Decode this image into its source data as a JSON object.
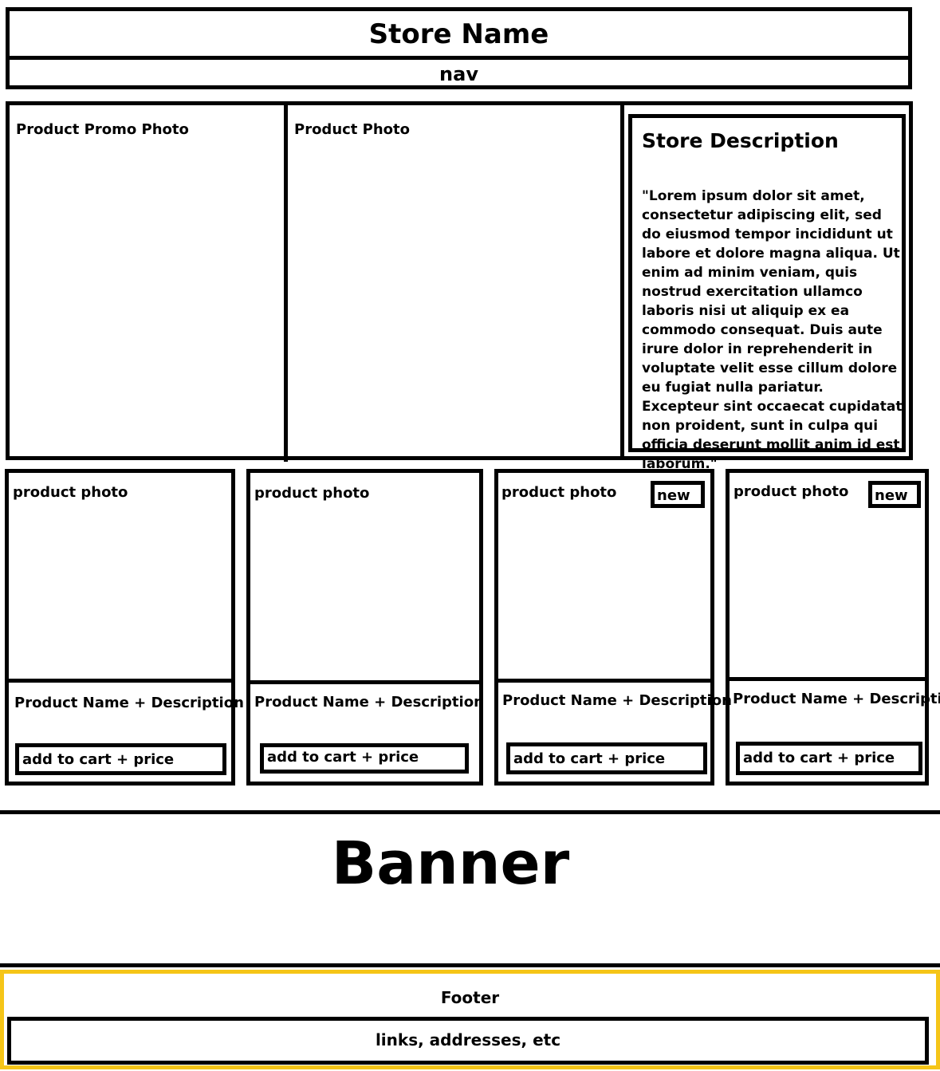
{
  "header": {
    "store_name": "Store Name",
    "nav": "nav"
  },
  "hero": {
    "promo_photo": "Product Promo Photo",
    "product_photo": "Product Photo",
    "description": {
      "title": "Store Description",
      "text": "\"Lorem ipsum dolor sit amet, consectetur adipiscing elit, sed do eiusmod tempor incididunt ut labore et dolore magna aliqua. Ut enim ad minim veniam, quis nostrud exercitation ullamco laboris nisi ut aliquip ex ea commodo consequat. Duis aute irure dolor in reprehenderit in voluptate velit esse cillum dolore eu fugiat nulla pariatur. Excepteur sint occaecat cupidatat non proident, sunt in culpa qui officia deserunt mollit anim id est laborum.\""
    }
  },
  "products": [
    {
      "photo": "product photo",
      "name": "Product Name + Description",
      "cart": "add to cart + price"
    },
    {
      "photo": "product photo",
      "name": "Product Name + Description",
      "cart": "add to cart + price"
    },
    {
      "photo": "product photo",
      "name": "Product Name + Description",
      "cart": "add to cart + price",
      "badge": "new"
    },
    {
      "photo": "product photo",
      "name": "Product Name + Description",
      "cart": "add to cart + price",
      "badge": "new"
    }
  ],
  "banner": {
    "label": "Banner"
  },
  "footer": {
    "label": "Footer",
    "links": "links, addresses, etc",
    "border_color": "#f5c518"
  }
}
